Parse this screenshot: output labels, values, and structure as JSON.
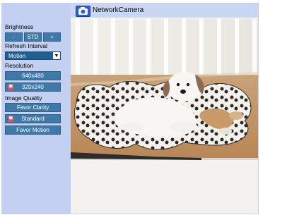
{
  "header": {
    "title": "NetworkCamera"
  },
  "sidebar": {
    "brightness": {
      "label": "Brightness",
      "minus": "-",
      "std": "STD",
      "plus": "+"
    },
    "refresh": {
      "label": "Refresh Interval",
      "selected": "Motion"
    },
    "resolution": {
      "label": "Resolution",
      "options": [
        "640x480",
        "320x240"
      ],
      "selected_index": 1
    },
    "image_quality": {
      "label": "Image Quality",
      "options": [
        "Favor Clarity",
        "Standard",
        "Favor Motion"
      ],
      "selected_index": 1
    }
  },
  "icons": {
    "camera": "camera-icon",
    "dropdown": "chevron-down-icon"
  },
  "colors": {
    "accent": "#3f79a8",
    "sidebar_bg": "#c4d0f2",
    "selected_marker": "#e0535c"
  }
}
